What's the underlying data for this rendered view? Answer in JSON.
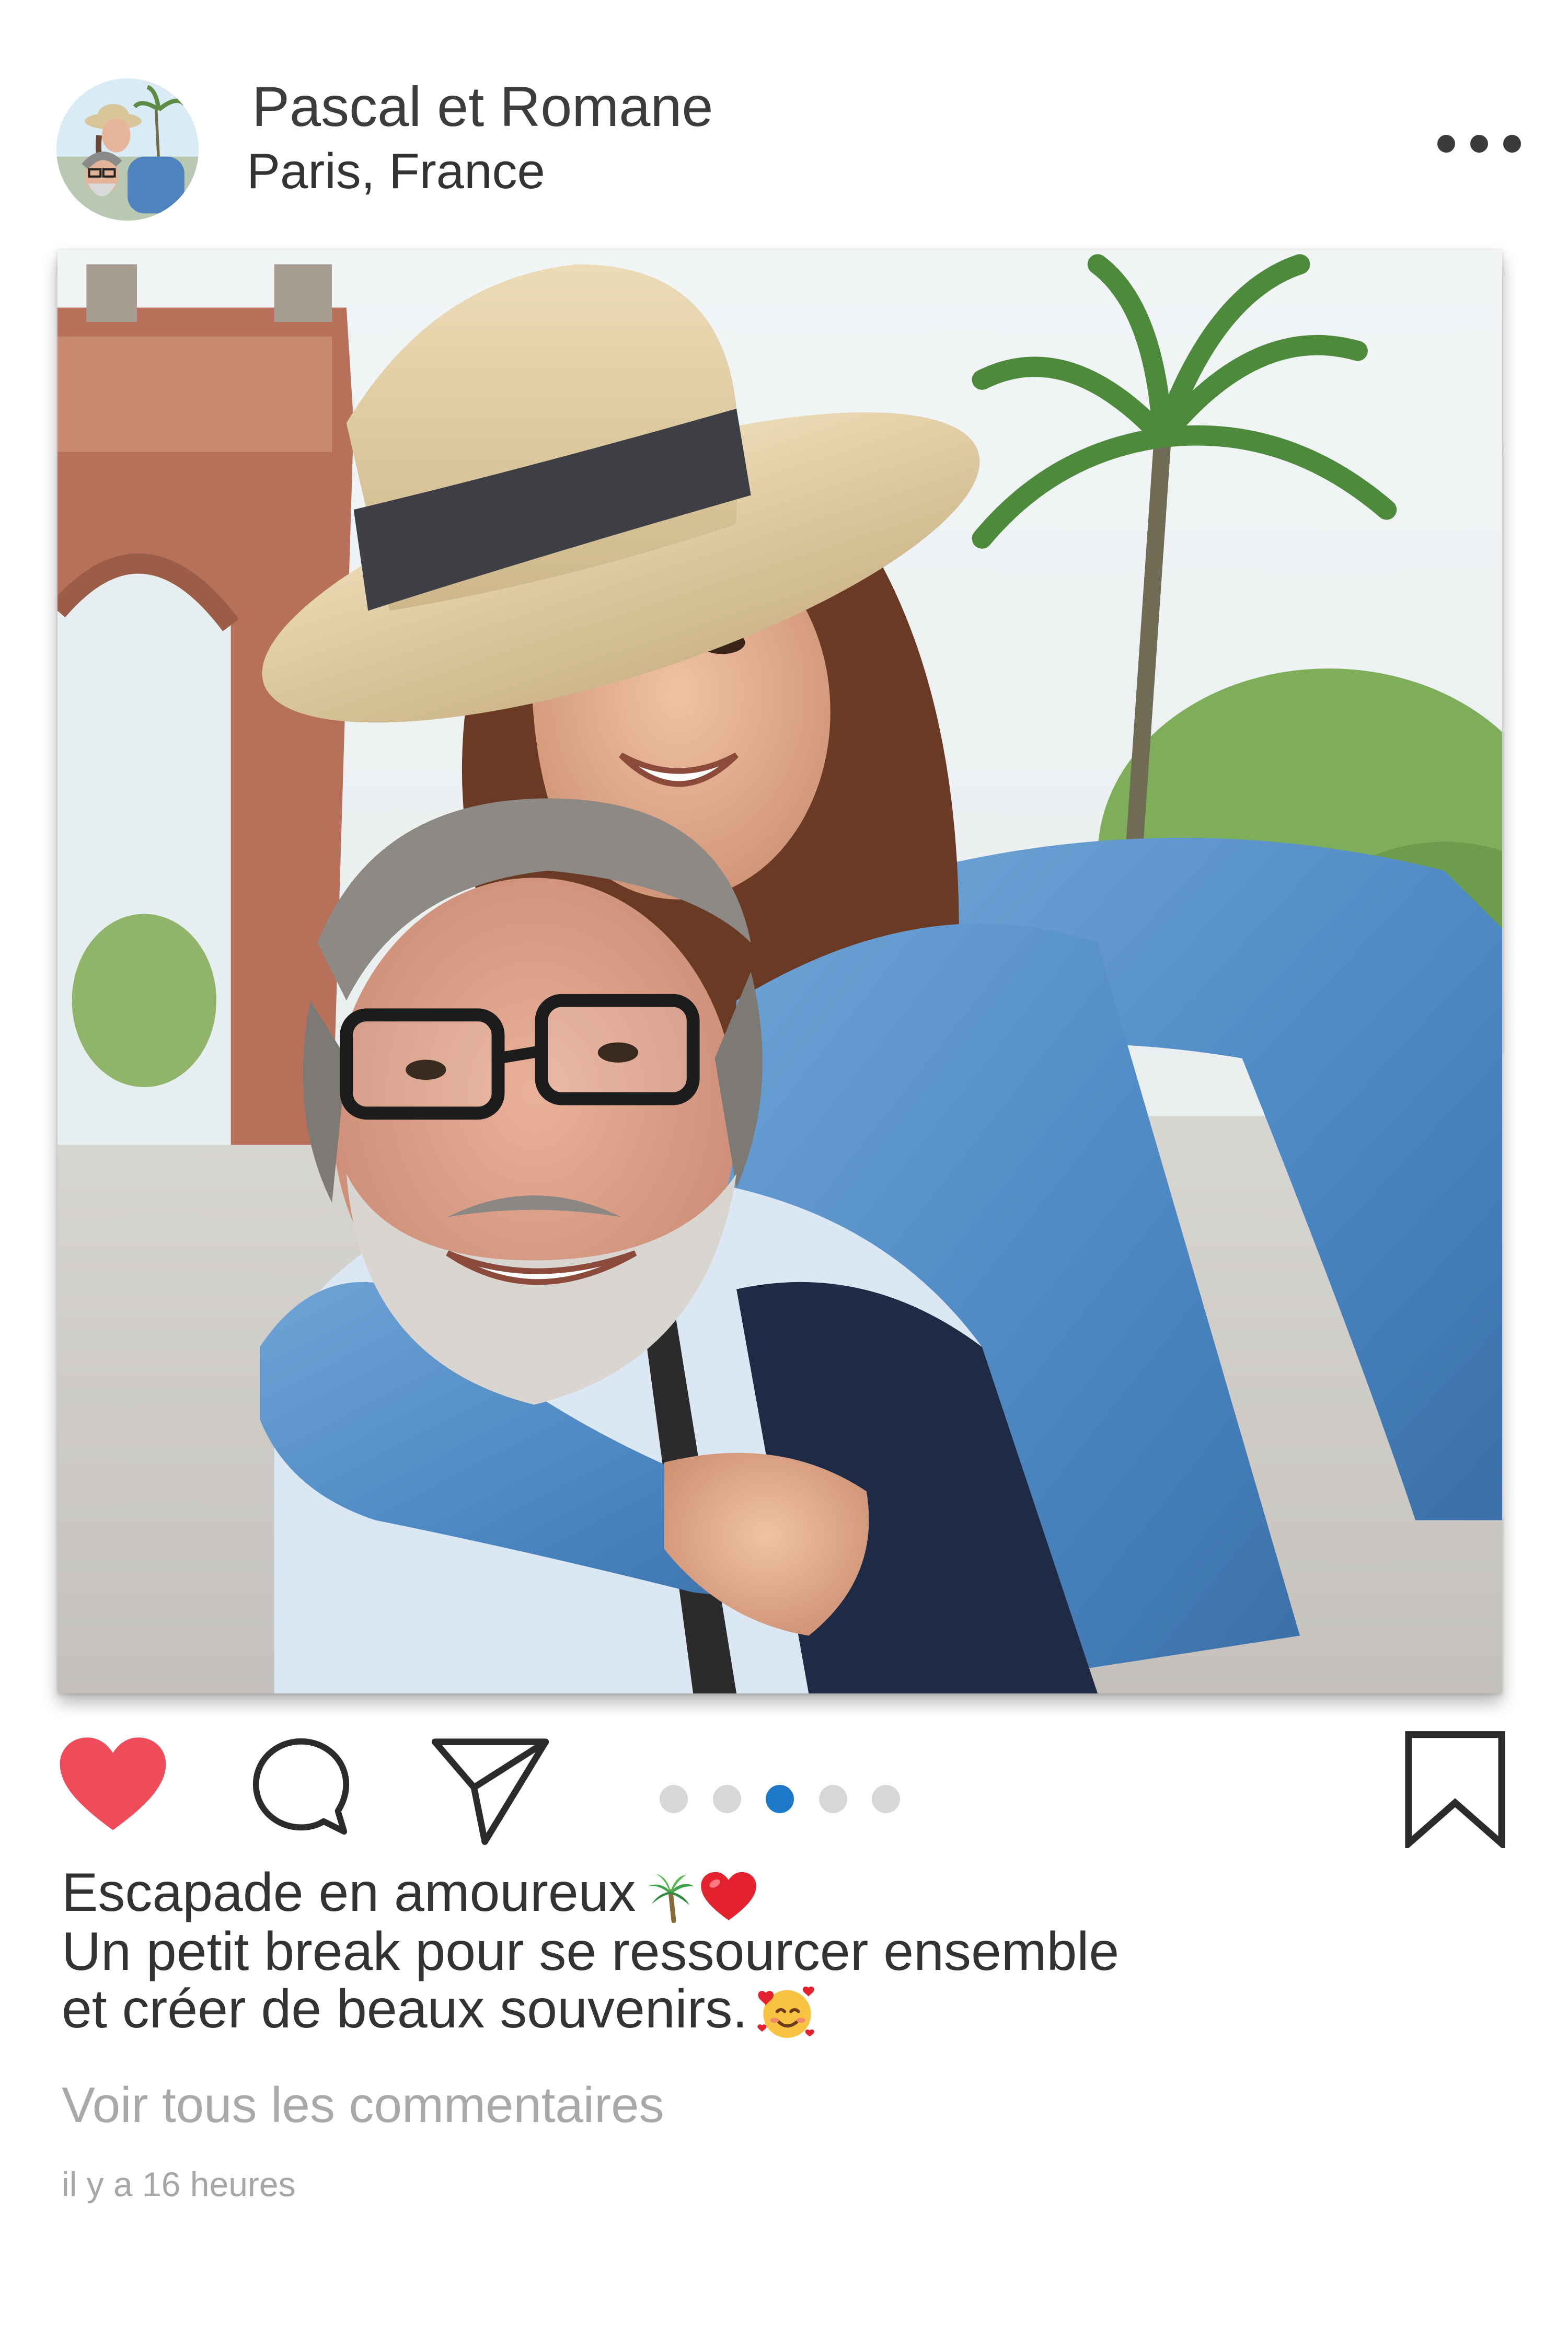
{
  "post": {
    "author": {
      "name": "Pascal et Romane",
      "location": "Paris, France",
      "avatar_icon": "couple-avatar"
    },
    "menu_icon": "more-horizontal-icon",
    "photo": {
      "description_icon": "couple-selfie-photo"
    },
    "actions": {
      "like_icon": "heart-filled-icon",
      "like_color": "#ef4b5a",
      "comment_icon": "comment-bubble-icon",
      "share_icon": "paper-plane-icon",
      "save_icon": "bookmark-icon"
    },
    "carousel": {
      "count": 5,
      "active_index": 2,
      "active_color": "#1d78c9",
      "inactive_color": "#d7d7d7"
    },
    "caption": {
      "line1": "Escapade en amoureux",
      "line1_emojis": [
        "palm-tree-emoji",
        "red-heart-emoji"
      ],
      "line2": "Un petit break pour se ressourcer ensemble",
      "line3": "et créer de beaux souvenirs.",
      "line3_emoji": "smiling-face-with-hearts-emoji"
    },
    "comments_link": "Voir tous les commentaires",
    "timestamp": "il y a 16 heures"
  }
}
